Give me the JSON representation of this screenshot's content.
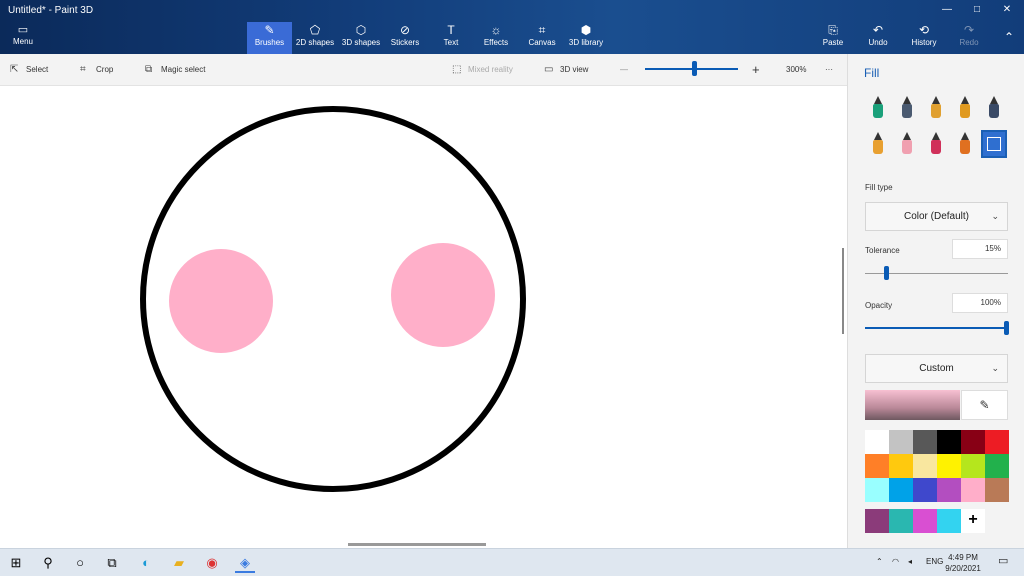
{
  "window": {
    "title": "Untitled* - Paint 3D",
    "min": "—",
    "max": "□",
    "close": "✕"
  },
  "ribbon": {
    "menu_label": "Menu",
    "tabs": [
      {
        "label": "Brushes",
        "icon": "brush-icon",
        "glyph": "✎"
      },
      {
        "label": "2D shapes",
        "icon": "2d-shapes-icon",
        "glyph": "⬠"
      },
      {
        "label": "3D shapes",
        "icon": "3d-shapes-icon",
        "glyph": "⬡"
      },
      {
        "label": "Stickers",
        "icon": "stickers-icon",
        "glyph": "⊘"
      },
      {
        "label": "Text",
        "icon": "text-icon",
        "glyph": "T"
      },
      {
        "label": "Effects",
        "icon": "effects-icon",
        "glyph": "☼"
      },
      {
        "label": "Canvas",
        "icon": "canvas-icon",
        "glyph": "⌗"
      },
      {
        "label": "3D library",
        "icon": "3d-library-icon",
        "glyph": "⬢"
      }
    ],
    "right": [
      {
        "label": "Paste",
        "icon": "paste-icon",
        "glyph": "📋"
      },
      {
        "label": "Undo",
        "icon": "undo-icon",
        "glyph": "↶"
      },
      {
        "label": "History",
        "icon": "history-icon",
        "glyph": "⟲"
      },
      {
        "label": "Redo",
        "icon": "redo-icon",
        "glyph": "↷"
      }
    ]
  },
  "toolbar": {
    "select": "Select",
    "crop": "Crop",
    "magic_select": "Magic select",
    "mixed_reality": "Mixed reality",
    "view_3d": "3D view",
    "zoom_out": "—",
    "zoom_in": "+",
    "zoom_level": "300%",
    "more": "···",
    "zoom_fraction": 0.53
  },
  "panel": {
    "title": "Fill",
    "fill_type_label": "Fill type",
    "fill_type_value": "Color (Default)",
    "tolerance_label": "Tolerance",
    "tolerance_value": "15%",
    "tolerance_fraction": 0.15,
    "opacity_label": "Opacity",
    "opacity_value": "100%",
    "opacity_fraction": 1.0,
    "color_mode": "Custom",
    "brushes": [
      {
        "name": "marker-icon",
        "color": "#1aa07a"
      },
      {
        "name": "calligraphy-pen-icon",
        "color": "#4a5a70"
      },
      {
        "name": "oil-brush-icon",
        "color": "#e0a030"
      },
      {
        "name": "watercolor-icon",
        "color": "#e09a20"
      },
      {
        "name": "pixel-pen-icon",
        "color": "#3a4a66"
      },
      {
        "name": "pencil-icon",
        "color": "#e8a030"
      },
      {
        "name": "eraser-icon",
        "color": "#f0a0b0"
      },
      {
        "name": "crayon-icon",
        "color": "#d0305a"
      },
      {
        "name": "spray-can-icon",
        "color": "#e07020"
      },
      {
        "name": "fill-bucket-icon",
        "color": "#2f6fd0"
      }
    ],
    "palette": [
      "#ffffff",
      "#c3c3c3",
      "#585858",
      "#000000",
      "#880015",
      "#ed1c24",
      "#ff7f27",
      "#ffc90e",
      "#f9e79f",
      "#fff200",
      "#b5e61d",
      "#22b14c",
      "#99ffff",
      "#00a2e8",
      "#3f48cc",
      "#b34ec0",
      "#ffaec9",
      "#b97a57"
    ],
    "custom_colors": [
      "#8b3b7a",
      "#2ab7b0",
      "#d94fd2",
      "#33d3f0"
    ],
    "add_color": "+"
  },
  "canvas_art": {
    "face_stroke": "#000000",
    "cheek_color": "#ffafc9"
  },
  "taskbar": {
    "tray": {
      "lang": "ENG",
      "time": "4:49 PM",
      "date": "9/20/2021"
    }
  }
}
